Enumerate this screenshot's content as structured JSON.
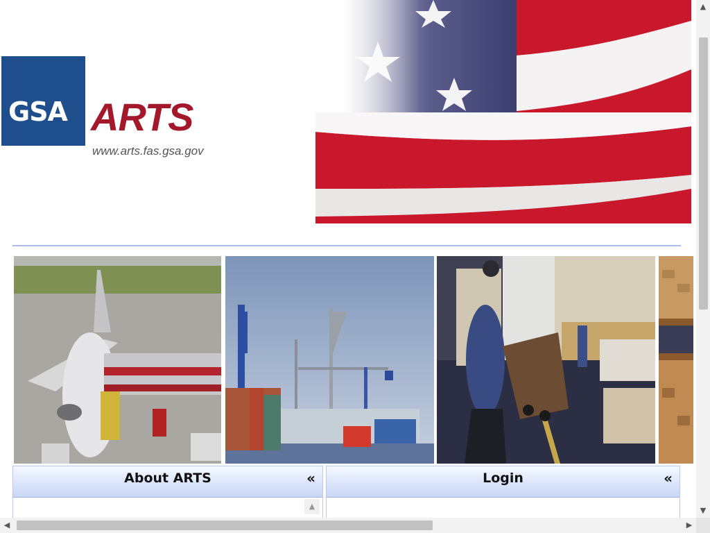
{
  "logo": {
    "gsa": "GSA",
    "arts": "ARTS",
    "url": "www.arts.fas.gsa.gov"
  },
  "banner": {
    "image": "american-flag"
  },
  "photos": [
    {
      "name": "airplane-cargo-loading"
    },
    {
      "name": "shipping-port-cranes"
    },
    {
      "name": "warehouse-hand-truck"
    },
    {
      "name": "warehouse-boxes"
    }
  ],
  "panels": {
    "about": {
      "title": "About ARTS",
      "collapse": "«"
    },
    "login": {
      "title": "Login",
      "collapse": "«"
    }
  },
  "scrollbars": {
    "up": "▲",
    "down": "▼",
    "left": "◀",
    "right": "▶"
  },
  "colors": {
    "gsa_blue": "#1f4e8c",
    "arts_red": "#a3182a",
    "divider": "#aabcf0"
  }
}
